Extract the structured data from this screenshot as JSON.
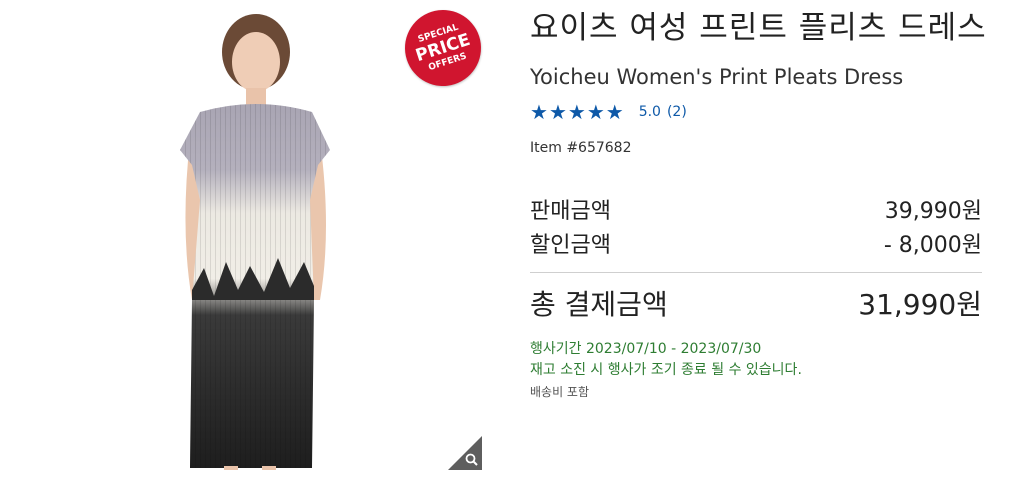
{
  "product": {
    "title_ko": "요이츠 여성 프린트 플리츠 드레스",
    "title_en": "Yoicheu Women's Print Pleats Dress",
    "rating": {
      "stars": 5,
      "score": "5.0",
      "count": "(2)"
    },
    "item_number": "Item #657682"
  },
  "badge": {
    "line1": "SPECIAL",
    "line2": "PRICE",
    "line3": "OFFERS"
  },
  "icons": {
    "zoom": "magnifier-icon",
    "star": "star-icon"
  },
  "pricing": {
    "sale_label": "판매금액",
    "sale_value": "39,990원",
    "discount_label": "할인금액",
    "discount_value": "- 8,000원",
    "total_label": "총 결제금액",
    "total_value": "31,990원"
  },
  "promo": {
    "period": "행사기간 2023/07/10 - 2023/07/30",
    "note": "재고 소진 시 행사가 조기 종료 될 수 있습니다.",
    "shipping": "배송비 포함"
  },
  "colors": {
    "accent_blue": "#0e59a8",
    "promo_green": "#2e7d32",
    "badge_red": "#d0152f"
  }
}
